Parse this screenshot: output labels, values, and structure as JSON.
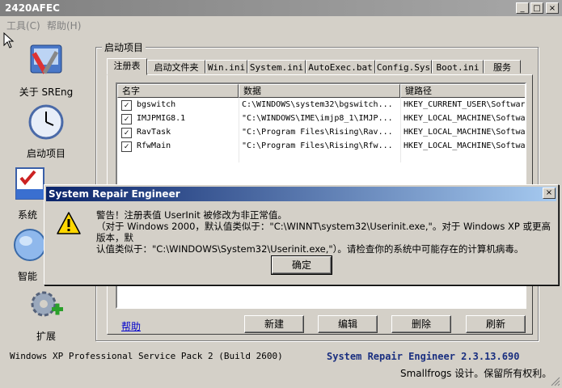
{
  "window": {
    "title": "2420AFEC",
    "min_label": "_",
    "max_label": "□",
    "close_label": "×"
  },
  "menu": [
    {
      "label": "工具(C)"
    },
    {
      "label": "帮助(H)"
    }
  ],
  "sidebar": {
    "items": [
      {
        "label": "关于 SREng",
        "icon": "tools-icon"
      },
      {
        "label": "启动项目",
        "icon": "clock-icon"
      },
      {
        "label": "系统",
        "icon": "checklist-icon"
      },
      {
        "label": "智能",
        "icon": "globe-icon"
      },
      {
        "label": "扩展",
        "icon": "gear-plus-icon"
      }
    ]
  },
  "group": {
    "label": "启动项目"
  },
  "tabs": [
    {
      "label": "注册表",
      "active": true
    },
    {
      "label": "启动文件夹"
    },
    {
      "label": "Win.ini"
    },
    {
      "label": "System.ini"
    },
    {
      "label": "AutoExec.bat"
    },
    {
      "label": "Config.Sys"
    },
    {
      "label": "Boot.ini"
    },
    {
      "label": "服务"
    }
  ],
  "list": {
    "columns": [
      "名字",
      "数据",
      "键路径"
    ],
    "rows": [
      {
        "checked": true,
        "name": "bgswitch",
        "data": "C:\\WINDOWS\\system32\\bgswitch...",
        "path": "HKEY_CURRENT_USER\\Softwar"
      },
      {
        "checked": true,
        "name": "IMJPMIG8.1",
        "data": "\"C:\\WINDOWS\\IME\\imjp8_1\\IMJP...",
        "path": "HKEY_LOCAL_MACHINE\\Softwa"
      },
      {
        "checked": true,
        "name": "RavTask",
        "data": "\"C:\\Program Files\\Rising\\Rav...",
        "path": "HKEY_LOCAL_MACHINE\\Softwa"
      },
      {
        "checked": true,
        "name": "RfwMain",
        "data": "\"C:\\Program Files\\Rising\\Rfw...",
        "path": "HKEY_LOCAL_MACHINE\\Softwa"
      }
    ]
  },
  "buttons": {
    "help": "帮助",
    "new": "新建",
    "edit": "编辑",
    "delete": "删除",
    "refresh": "刷新"
  },
  "status": {
    "os": "Windows XP Professional Service Pack 2 (Build 2600)",
    "app": "System Repair Engineer 2.3.13.690",
    "copyright": "Smallfrogs 设计。保留所有权利。"
  },
  "dialog": {
    "title": "System Repair Engineer",
    "close_label": "×",
    "line1": "警告！注册表值 UserInit 被修改为非正常值。",
    "line2": "（对于 Windows 2000，默认值类似于：\"C:\\WINNT\\system32\\Userinit.exe,\"。对于 Windows XP 或更高版本，默",
    "line3": "认值类似于：\"C:\\WINDOWS\\System32\\Userinit.exe,\"）。请检查你的系统中可能存在的计算机病毒。",
    "ok_label": "确定",
    "icon": "warning-icon"
  },
  "colors": {
    "dialog_title": "#0a246a",
    "status_app": "#1a2f80",
    "link": "#0000cc"
  }
}
